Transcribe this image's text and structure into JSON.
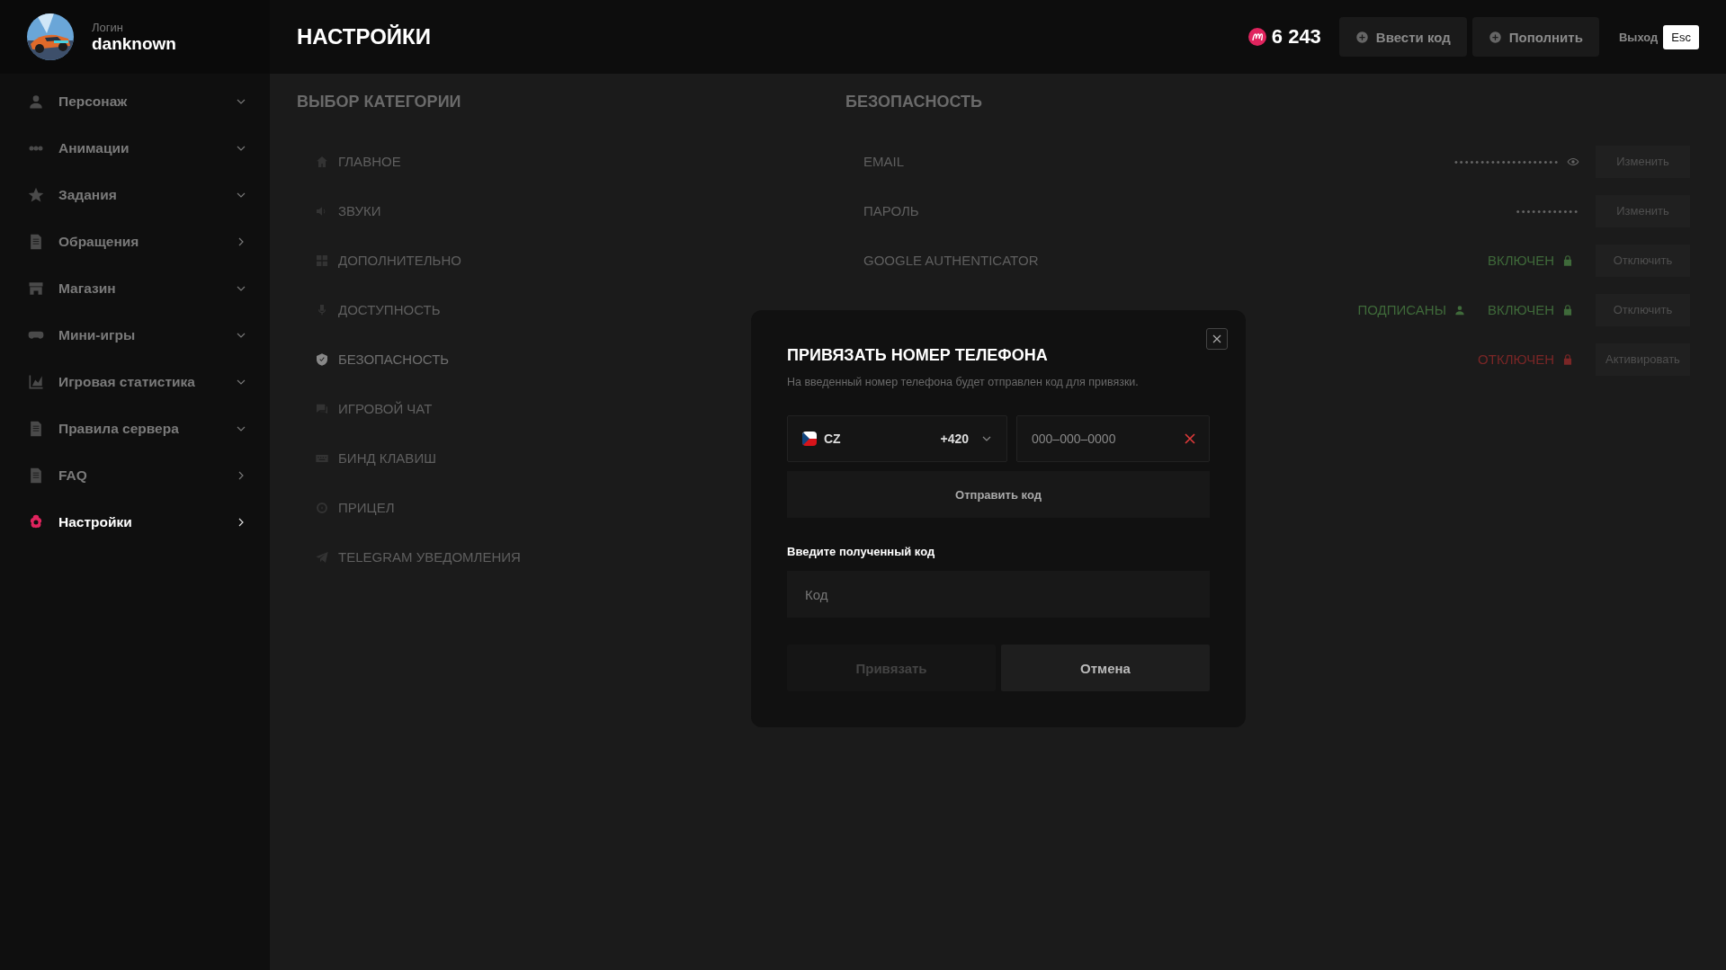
{
  "profile": {
    "label": "Логин",
    "name": "danknown"
  },
  "nav": [
    {
      "label": "Персонаж",
      "kind": "dropdown",
      "selected": false
    },
    {
      "label": "Анимации",
      "kind": "dropdown",
      "selected": false
    },
    {
      "label": "Задания",
      "kind": "dropdown",
      "selected": false
    },
    {
      "label": "Обращения",
      "kind": "link",
      "selected": false
    },
    {
      "label": "Магазин",
      "kind": "dropdown",
      "selected": false
    },
    {
      "label": "Мини-игры",
      "kind": "dropdown",
      "selected": false
    },
    {
      "label": "Игровая статистика",
      "kind": "dropdown",
      "selected": false
    },
    {
      "label": "Правила сервера",
      "kind": "dropdown",
      "selected": false
    },
    {
      "label": "FAQ",
      "kind": "link",
      "selected": false
    },
    {
      "label": "Настройки",
      "kind": "link",
      "selected": true
    }
  ],
  "header": {
    "title": "НАСТРОЙКИ",
    "balance": "6 243",
    "actions": [
      "Ввести код",
      "Пополнить"
    ],
    "exit": "Выход",
    "exit_key": "Esc"
  },
  "categories": {
    "title": "ВЫБОР КАТЕГОРИИ",
    "items": [
      {
        "label": "ГЛАВНОЕ",
        "selected": false
      },
      {
        "label": "ЗВУКИ",
        "selected": false
      },
      {
        "label": "ДОПОЛНИТЕЛЬНО",
        "selected": false
      },
      {
        "label": "ДОСТУПНОСТЬ",
        "selected": false
      },
      {
        "label": "БЕЗОПАСНОСТЬ",
        "selected": true
      },
      {
        "label": "ИГРОВОЙ ЧАТ",
        "selected": false
      },
      {
        "label": "БИНД КЛАВИШ",
        "selected": false
      },
      {
        "label": "ПРИЦЕЛ",
        "selected": false
      },
      {
        "label": "TELEGRAM УВЕДОМЛЕНИЯ",
        "selected": false
      }
    ]
  },
  "security": {
    "title": "БЕЗОПАСНОСТЬ",
    "rows": [
      {
        "kind": "masked",
        "label": "EMAIL",
        "masked": "••••••••••••••••••••",
        "reveal": true,
        "action": "Изменить"
      },
      {
        "kind": "masked",
        "label": "ПАРОЛЬ",
        "masked": "••••••••••••",
        "reveal": false,
        "action": "Изменить"
      },
      {
        "kind": "status",
        "label": "GOOGLE AUTHENTICATOR",
        "status": "ВКЛЮЧЕН",
        "on": true,
        "action": "Отключить"
      },
      {
        "kind": "status",
        "extra": "ПОДПИСАНЫ",
        "status": "ВКЛЮЧЕН",
        "on": true,
        "action": "Отключить"
      },
      {
        "kind": "status",
        "status": "ОТКЛЮЧЕН",
        "on": false,
        "action": "Активировать"
      }
    ]
  },
  "modal": {
    "title": "ПРИВЯЗАТЬ НОМЕР ТЕЛЕФОНА",
    "description": "На введенный номер телефона будет отправлен код для привязки.",
    "country": {
      "code": "CZ",
      "dial": "+420"
    },
    "phone_placeholder": "000–000–0000",
    "send": "Отправить код",
    "code_label": "Введите полученный код",
    "code_placeholder": "Код",
    "buttons": [
      {
        "label": "Привязать",
        "disabled": true
      },
      {
        "label": "Отмена",
        "disabled": false
      }
    ]
  }
}
